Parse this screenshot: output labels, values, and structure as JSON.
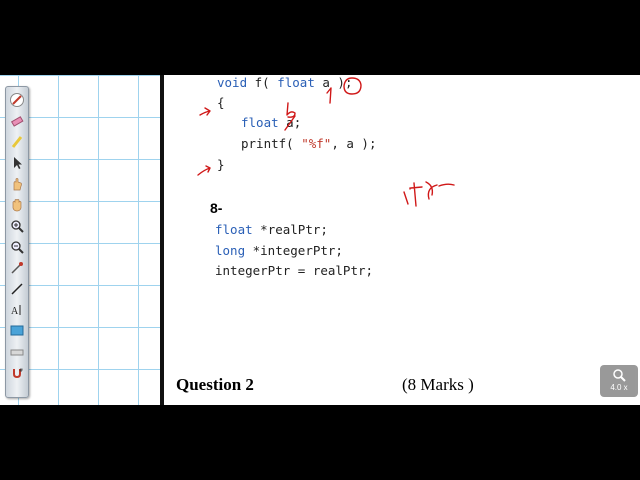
{
  "code_block_top": {
    "line1": {
      "kw1": "void",
      "rest1": " f( ",
      "kw2": "float",
      "rest2": " a );"
    },
    "line2": "{",
    "line3": {
      "kw": "float",
      "rest": " a;"
    },
    "line4": {
      "pre": "printf( ",
      "str": "\"%f\"",
      "post": ", a );"
    },
    "line5": "}"
  },
  "question_item_number": "8-",
  "code_block_bottom": {
    "line1": {
      "kw": "float",
      "rest": " *realPtr;"
    },
    "line2": {
      "kw": "long",
      "rest": " *integerPtr;"
    },
    "line3": "integerPtr = realPtr;"
  },
  "question": {
    "title": "Question 2",
    "marks": "(8 Marks )"
  },
  "zoom_indicator": {
    "level": "4.0 x",
    "icon": "magnifier-icon"
  },
  "toolbar": {
    "tools": [
      "pen-icon",
      "eraser-icon",
      "highlighter-icon",
      "pointer-icon",
      "laser-hand-icon",
      "pan-hand-icon",
      "zoom-in-icon",
      "zoom-out-icon",
      "dropper-icon",
      "line-icon",
      "text-icon",
      "screen-icon",
      "ruler-icon",
      "magnet-icon"
    ]
  },
  "colors": {
    "ink": "#d01818",
    "keyword": "#2a5fb6",
    "string": "#c0392b",
    "grid": "#9fd3ee"
  }
}
